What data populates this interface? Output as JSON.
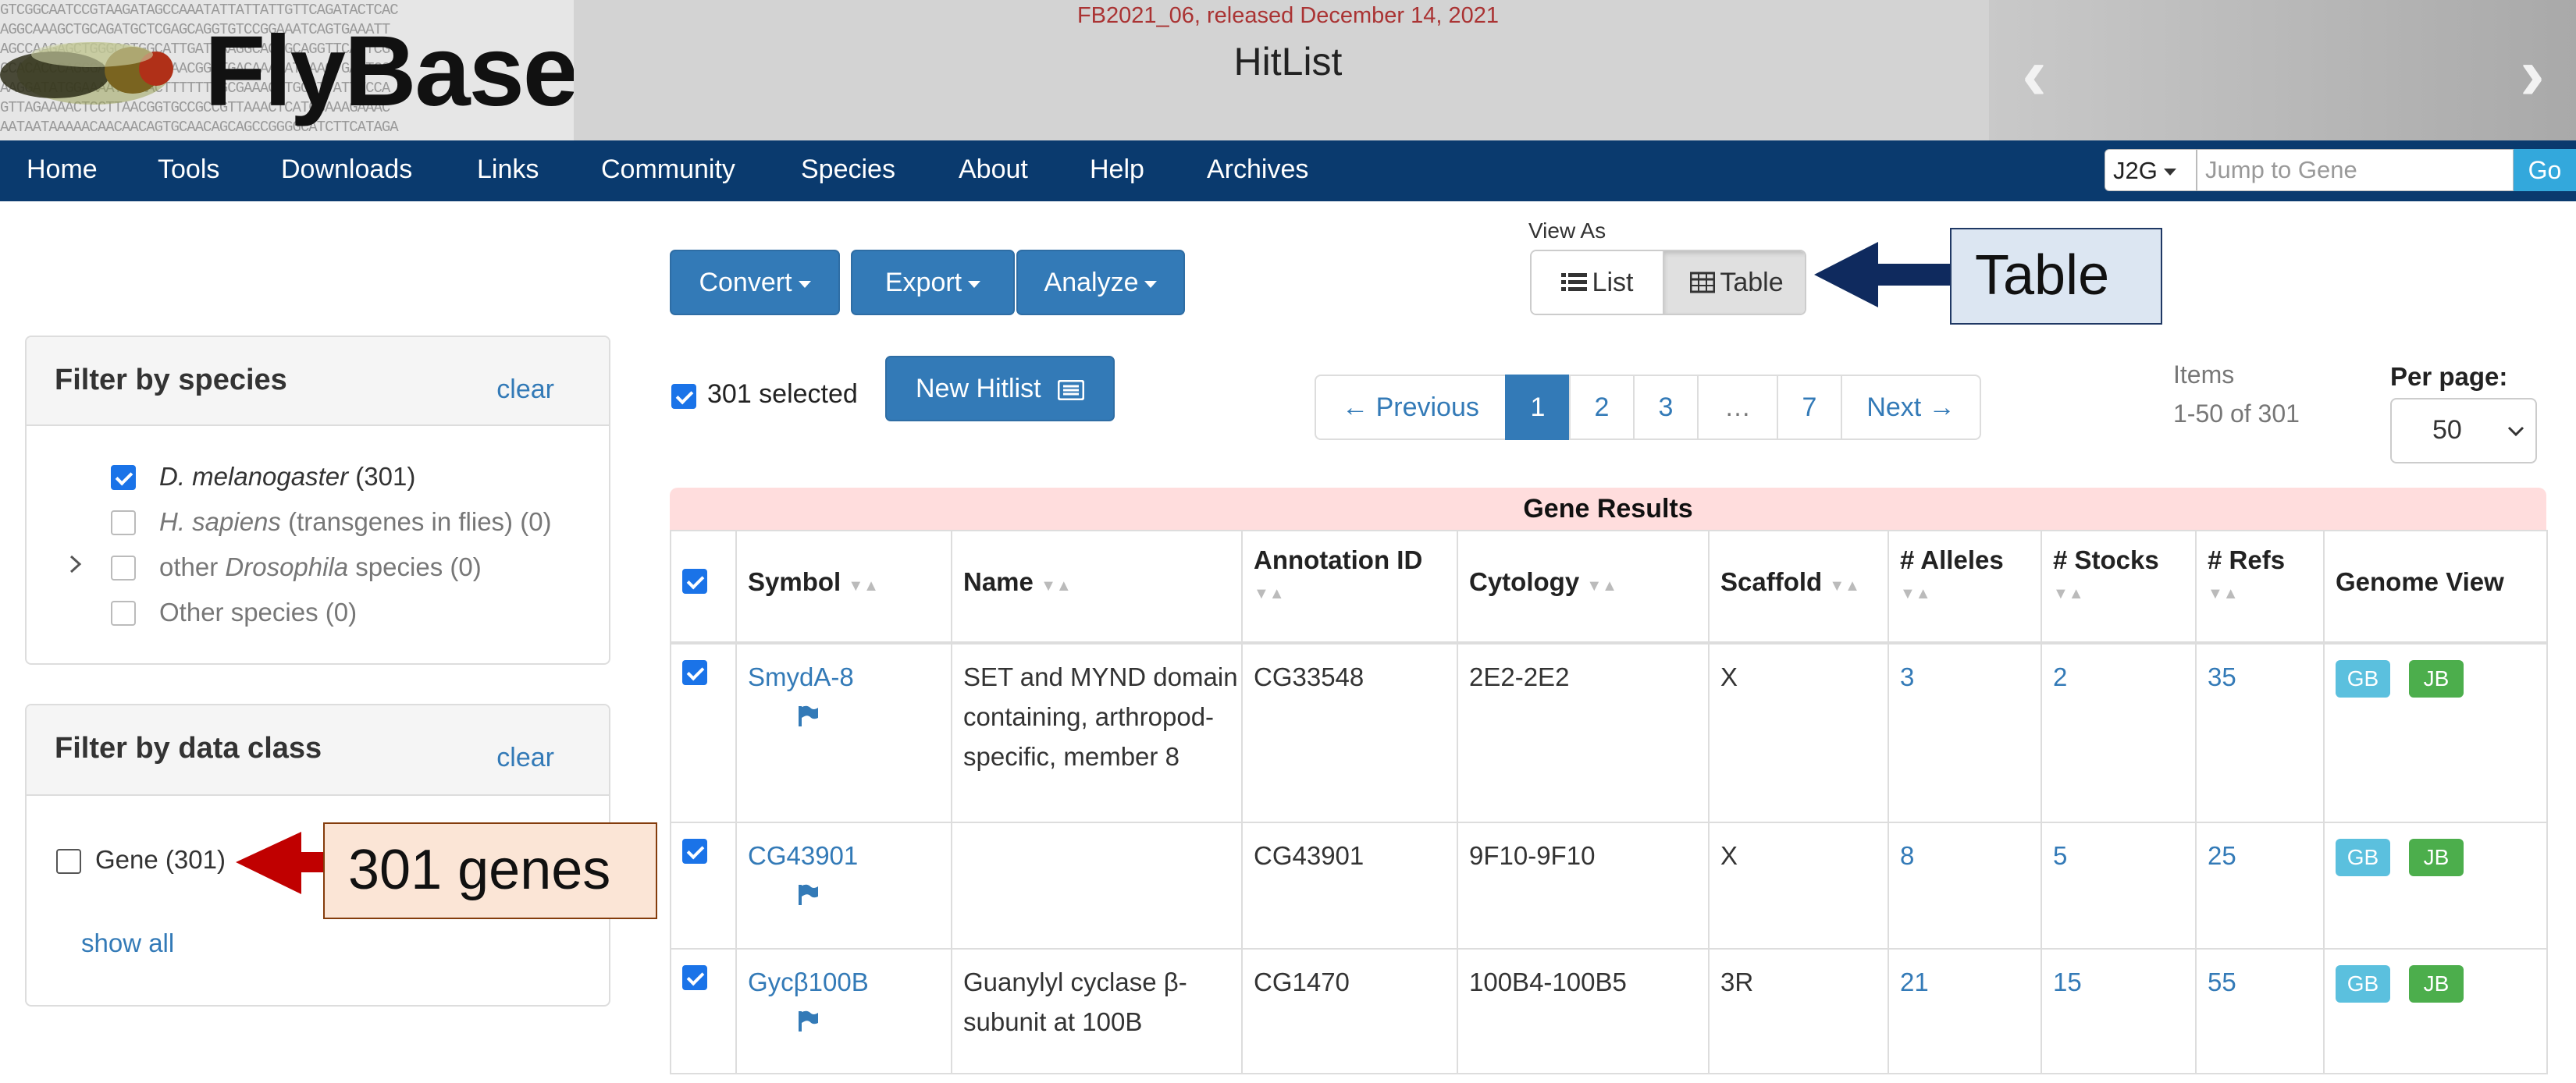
{
  "header": {
    "release": "FB2021_06, released December 14, 2021",
    "title": "HitList",
    "logo_text": "FlyBase",
    "dna_lines": [
      "GTCGGCAATCCGTAAGATAGCCAAATATTATTATTGTTCAGATACTCAC",
      "AGGCAAAGCTGCAGATGCTCGAGCAGGTGTCCGGAAATCAGTGAAATT",
      "AGCCAAGAGCTGGGCCTGGCATTGATGAAGGCACTGCAGGTTCACTCG",
      "CCACACCCAGGGACGCATGGGAACGGCTGACAAACATCAACTGACTCG",
      "AAGGATATGGAAAATACAACTTTTTTTGCGAAACTTGCGTTATTTCCA",
      "GTTAGAAAACTCCTTAACGGTGCCGCCGTTAAACTCATCCAAAGAAAC",
      "AATAATAAAAACAACAACAGTGCAACAGCAGCCGGGGCATCTTCATAGA"
    ],
    "carousel_prev": "‹",
    "carousel_next": "›"
  },
  "nav": {
    "items": [
      "Home",
      "Tools",
      "Downloads",
      "Links",
      "Community",
      "Species",
      "About",
      "Help",
      "Archives"
    ],
    "j2g_label": "J2G",
    "jump_placeholder": "Jump to Gene",
    "go_label": "Go"
  },
  "toolbar": {
    "convert": "Convert",
    "export": "Export",
    "analyze": "Analyze",
    "view_as": "View As",
    "list": "List",
    "table": "Table",
    "selected": "301 selected",
    "new_hitlist": "New Hitlist",
    "items_label": "Items",
    "items_range": "1-50 of 301",
    "per_page_label": "Per page:",
    "per_page_value": "50"
  },
  "pagination": {
    "previous": "← Previous",
    "pages": [
      "1",
      "2",
      "3",
      "…",
      "7"
    ],
    "next": "Next →",
    "active_page": "1"
  },
  "annotations": {
    "table_callout": "Table",
    "genes_callout": "301 genes",
    "table_callout_color": "#dce6f2",
    "genes_callout_color": "#fbe5d6",
    "table_arrow_color": "#0f2a5e",
    "genes_arrow_color": "#c00000"
  },
  "sidebar": {
    "species": {
      "title": "Filter by species",
      "clear": "clear",
      "items": [
        {
          "italic": "D. melanogaster",
          "pre": "",
          "post": " (301)",
          "checked": true
        },
        {
          "italic": "H. sapiens",
          "pre": "",
          "post": " (transgenes in flies) (0)",
          "checked": false
        },
        {
          "italic": "Drosophila",
          "pre": "other ",
          "post": " species (0)",
          "checked": false
        },
        {
          "italic": "",
          "pre": "Other species (0)",
          "post": "",
          "checked": false
        }
      ]
    },
    "dataclass": {
      "title": "Filter by data class",
      "clear": "clear",
      "gene_label": "Gene (301)",
      "show_all": "show all"
    }
  },
  "table": {
    "title": "Gene Results",
    "columns": [
      "Symbol",
      "Name",
      "Annotation ID",
      "Cytology",
      "Scaffold",
      "# Alleles",
      "# Stocks",
      "# Refs",
      "Genome View"
    ],
    "rows": [
      {
        "symbol": "SmydA-8",
        "name": "SET and MYND domain containing, arthropod-specific, member 8",
        "annotation_id": "CG33548",
        "cytology": "2E2-2E2",
        "scaffold": "X",
        "alleles": "3",
        "stocks": "2",
        "refs": "35",
        "gb": "GB",
        "jb": "JB"
      },
      {
        "symbol": "CG43901",
        "name": "",
        "annotation_id": "CG43901",
        "cytology": "9F10-9F10",
        "scaffold": "X",
        "alleles": "8",
        "stocks": "5",
        "refs": "25",
        "gb": "GB",
        "jb": "JB"
      },
      {
        "symbol": "Gycβ100B",
        "name": "Guanylyl cyclase β-subunit at 100B",
        "annotation_id": "CG1470",
        "cytology": "100B4-100B5",
        "scaffold": "3R",
        "alleles": "21",
        "stocks": "15",
        "refs": "55",
        "gb": "GB",
        "jb": "JB"
      }
    ]
  },
  "colors": {
    "navbar": "#0a3a6e",
    "link": "#337ab7",
    "gb": "#5bc0de",
    "jb": "#4cae4c",
    "results_bar": "#ffdddd"
  }
}
